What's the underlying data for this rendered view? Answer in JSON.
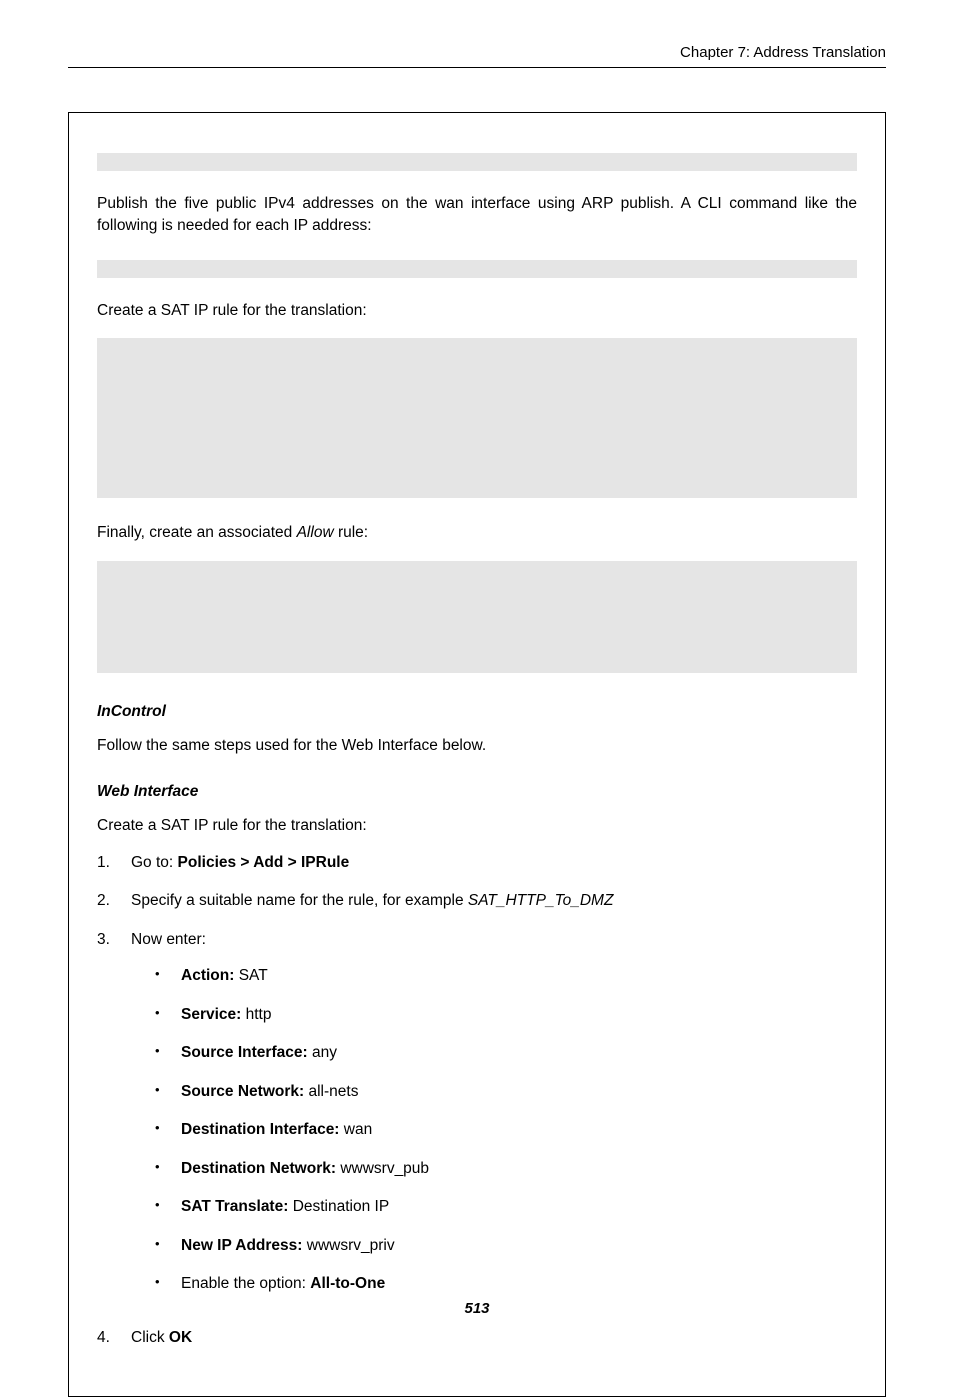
{
  "header": {
    "chapter": "Chapter 7: Address Translation"
  },
  "para1": "Publish the five public IPv4 addresses on the wan interface using ARP publish. A CLI command like the following is needed for each IP address:",
  "para2": "Create a SAT IP rule for the translation:",
  "para3_prefix": "Finally, create an associated ",
  "para3_ital": "Allow",
  "para3_suffix": " rule:",
  "incontrol": {
    "heading": "InControl",
    "text": "Follow the same steps used for the Web Interface below."
  },
  "webinterface": {
    "heading": "Web Interface",
    "intro": "Create a SAT IP rule for the translation:"
  },
  "steps": {
    "s1_prefix": "Go to: ",
    "s1_bold": "Policies > Add > IPRule",
    "s2_prefix": "Specify a suitable name for the rule, for example ",
    "s2_ital": "SAT_HTTP_To_DMZ",
    "s3": "Now enter:",
    "s4_prefix": "Click ",
    "s4_bold": "OK"
  },
  "bullets": {
    "b1_label": "Action:",
    "b1_val": " SAT",
    "b2_label": "Service:",
    "b2_val": " http",
    "b3_label": "Source Interface:",
    "b3_val": " any",
    "b4_label": "Source Network:",
    "b4_val": " all-nets",
    "b5_label": "Destination Interface:",
    "b5_val": " wan",
    "b6_label": "Destination Network:",
    "b6_val": " wwwsrv_pub",
    "b7_label": "SAT Translate: ",
    "b7_val": "Destination IP",
    "b8_label": "New IP Address:",
    "b8_val": " wwwsrv_priv",
    "b9_prefix": "Enable the option: ",
    "b9_bold": "All-to-One"
  },
  "page_number": "513"
}
